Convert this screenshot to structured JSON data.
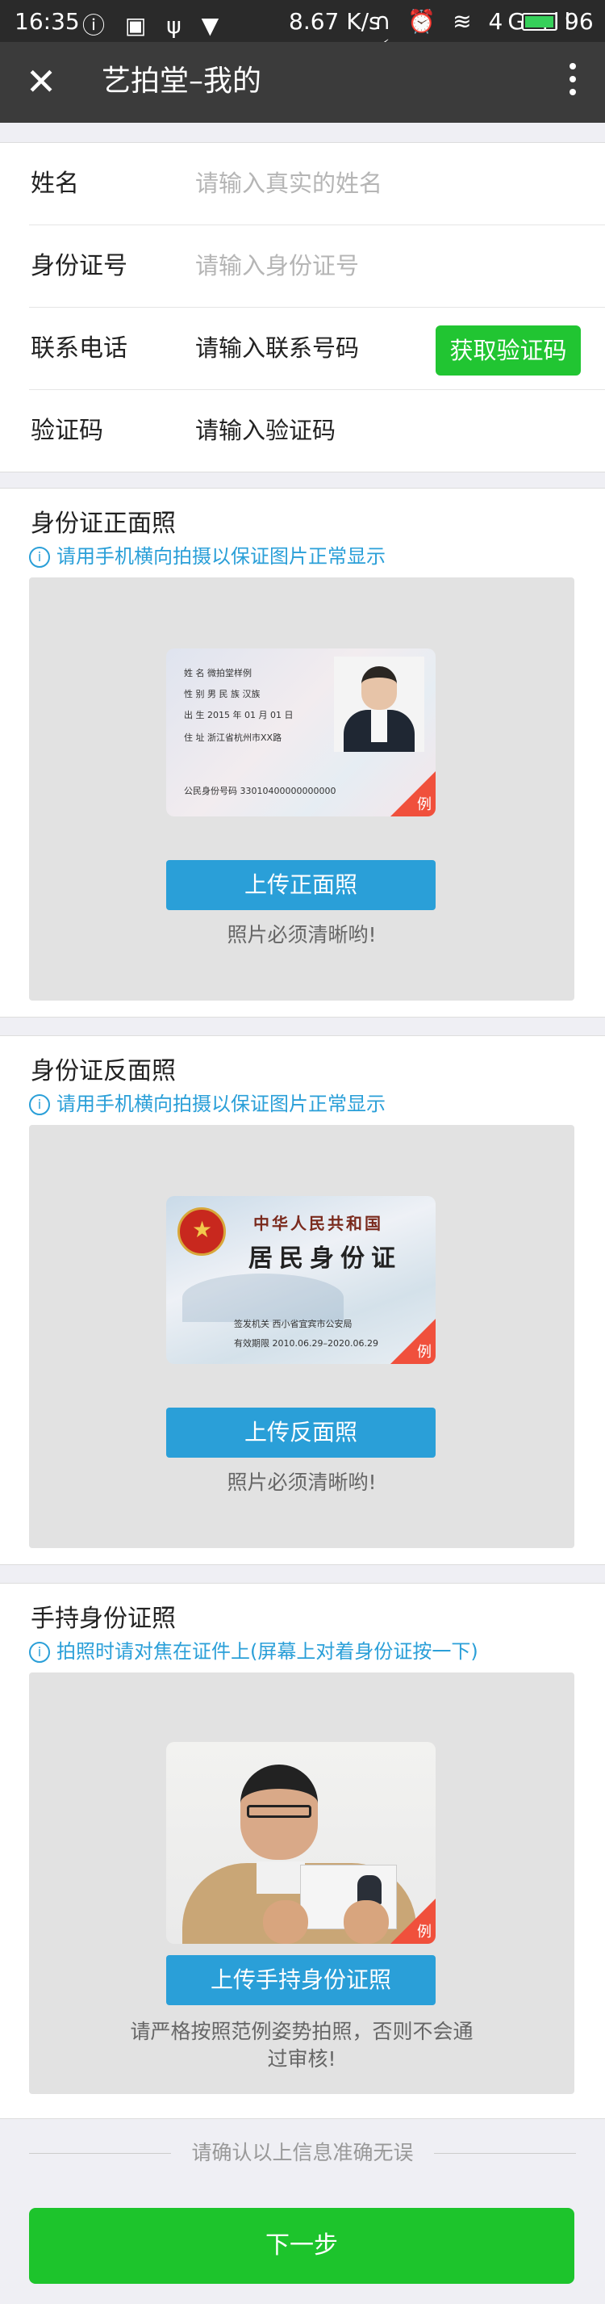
{
  "status_bar": {
    "time": "16:35",
    "left_icons": "ⓘ ▣ ψ ▼",
    "net_speed": "8.67 K/s",
    "right_icons": "∩ ⏰ ≋ 4G ıll ⚡",
    "battery": "96"
  },
  "navbar": {
    "close_icon": "✕",
    "title": "艺拍堂–我的",
    "more_icon": "more-vertical-icon"
  },
  "form": {
    "name_label": "姓名",
    "name_placeholder": "请输入真实的姓名",
    "id_label": "身份证号",
    "id_placeholder": "请输入身份证号",
    "phone_label": "联系电话",
    "phone_placeholder": "请输入联系号码",
    "sms_button": "获取验证码",
    "code_label": "验证码",
    "code_placeholder": "请输入验证码"
  },
  "front_section": {
    "title": "身份证正面照",
    "tip": "请用手机横向拍摄以保证图片正常显示",
    "card": {
      "name": "姓 名  微拍堂样例",
      "sex": "性 别 男      民 族 汉族",
      "birth": "出 生 2015    年 01 月 01 日",
      "address": "住 址  浙江省杭州市XX路",
      "number": "公民身份号码  33010400000000000"
    },
    "sample_tag": "例",
    "upload_button": "上传正面照",
    "note": "照片必须清晰哟!"
  },
  "back_section": {
    "title": "身份证反面照",
    "tip": "请用手机横向拍摄以保证图片正常显示",
    "card": {
      "country": "中华人民共和国",
      "title": "居民身份证",
      "authority": "签发机关    西小省宜宾市公安局",
      "validity": "有效期限    2010.06.29–2020.06.29"
    },
    "sample_tag": "例",
    "upload_button": "上传反面照",
    "note": "照片必须清晰哟!"
  },
  "hold_section": {
    "title": "手持身份证照",
    "tip": "拍照时请对焦在证件上(屏幕上对着身份证按一下)",
    "sample_tag": "例",
    "upload_button": "上传手持身份证照",
    "note": "请严格按照范例姿势拍照，否则不会通过审核!"
  },
  "confirm_text": "请确认以上信息准确无误",
  "next_button": "下一步",
  "colors": {
    "primary_green": "#1dc42c",
    "upload_blue": "#2a9fd8",
    "sample_red": "#f0503c"
  }
}
